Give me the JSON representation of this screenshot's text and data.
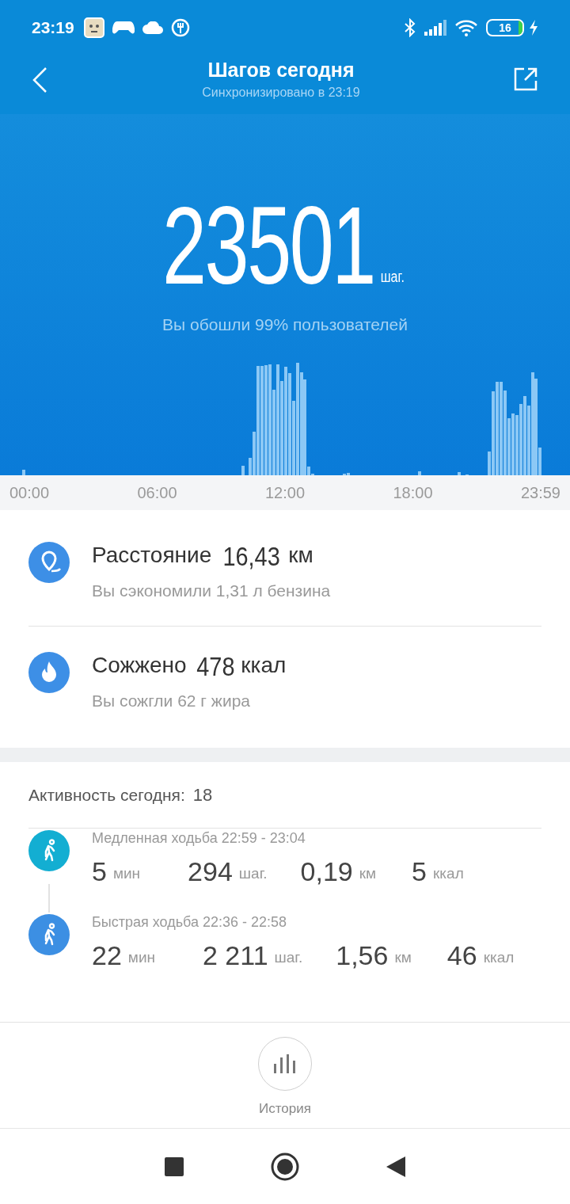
{
  "status_bar": {
    "time": "23:19",
    "battery": "16"
  },
  "header": {
    "title": "Шагов сегодня",
    "subtitle": "Синхронизировано в 23:19"
  },
  "steps": {
    "value": "23501",
    "unit": "шаг.",
    "comparison": "Вы обошли 99% пользователей"
  },
  "time_axis": [
    "00:00",
    "06:00",
    "12:00",
    "18:00",
    "23:59"
  ],
  "stats": [
    {
      "kind": "distance",
      "label": "Расстояние",
      "value": "16,43",
      "unit": "км",
      "note": "Вы сэкономили 1,31 л бензина"
    },
    {
      "kind": "calories",
      "label": "Сожжено",
      "value": "478",
      "unit": "ккал",
      "note": "Вы сожгли 62 г жира"
    }
  ],
  "activity": {
    "label": "Активность сегодня:",
    "count": "18",
    "items": [
      {
        "color": "#13aed2",
        "title": "Медленная ходьба 22:59 - 23:04",
        "metrics": [
          {
            "value": "5",
            "unit": "мин"
          },
          {
            "value": "294",
            "unit": "шаг."
          },
          {
            "value": "0,19",
            "unit": "км"
          },
          {
            "value": "5",
            "unit": "ккал"
          }
        ]
      },
      {
        "color": "#3c8fe3",
        "title": "Быстрая ходьба 22:36 - 22:58",
        "metrics": [
          {
            "value": "22",
            "unit": "мин"
          },
          {
            "value": "2 211",
            "unit": "шаг."
          },
          {
            "value": "1,56",
            "unit": "км"
          },
          {
            "value": "46",
            "unit": "ккал"
          }
        ]
      }
    ]
  },
  "bottom": {
    "history_label": "История"
  }
}
